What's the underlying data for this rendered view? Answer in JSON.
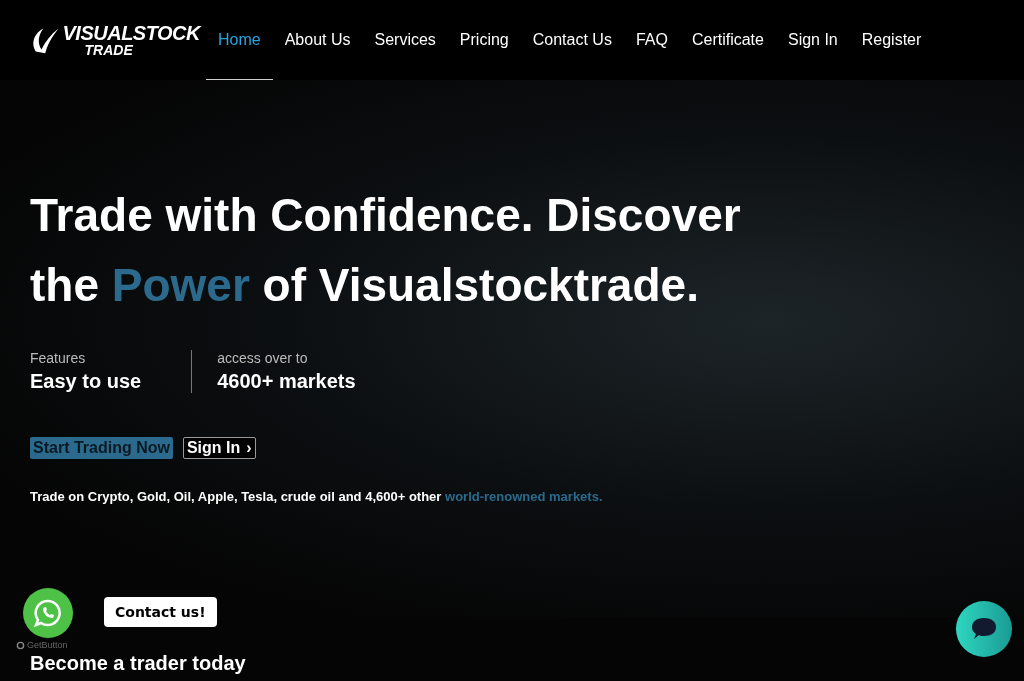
{
  "logo": {
    "line_1": "VISUALSTOCK",
    "line_2": "TRADE"
  },
  "nav": [
    {
      "label": "Home",
      "selected": true
    },
    {
      "label": "About Us",
      "selected": false
    },
    {
      "label": "Services",
      "selected": false
    },
    {
      "label": "Pricing",
      "selected": false
    },
    {
      "label": "Contact Us",
      "selected": false
    },
    {
      "label": "FAQ",
      "selected": false
    },
    {
      "label": "Certificate",
      "selected": false
    },
    {
      "label": "Sign In",
      "selected": false
    },
    {
      "label": "Register",
      "selected": false
    }
  ],
  "hero": {
    "headline": {
      "before": "Trade with Confidence. Discover the ",
      "highlight": "Power",
      "after": " of Visualstocktrade."
    },
    "stats": [
      {
        "label": "Features",
        "value": "Easy to use"
      },
      {
        "label": "access over to",
        "value": "4600+ markets"
      }
    ],
    "primary_button": "Start Trading Now",
    "secondary_button": "Sign In",
    "secondary_button_icon": "›",
    "tagline": "Trade on Crypto, Gold, Oil, Apple, Tesla, crude oil and 4,600+ other",
    "tagline_link": "world-renowned markets."
  },
  "next_section": {
    "title": "Become a trader today"
  },
  "whatsapp_widget": {
    "bubble": "Contact us!",
    "credit": "GetButton"
  }
}
